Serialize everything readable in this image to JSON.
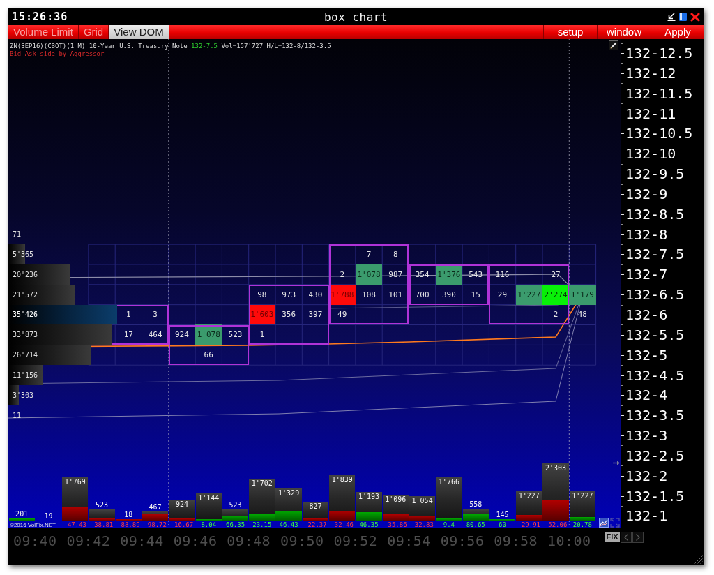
{
  "title_bar": {
    "clock": "15:26:36",
    "title": "box chart"
  },
  "menu": {
    "toggles": [
      {
        "label": "Volume Limit",
        "on": false
      },
      {
        "label": "Grid",
        "on": false
      },
      {
        "label": "View DOM",
        "on": true
      }
    ],
    "actions": [
      "setup",
      "window",
      "Apply"
    ]
  },
  "info": {
    "instrument": "ZN(SEP16)(CBOT)(1 M) 10-Year U.S. Treasury Note",
    "last_price": "132-7.5",
    "stats": "Vol=157'727 H/L=132-8/132-3.5",
    "mode": "Bid-Ask side by Aggressor"
  },
  "price_rows": [
    {
      "price": "132-12.5"
    },
    {
      "price": "132-12"
    },
    {
      "price": "132-11.5"
    },
    {
      "price": "132-11"
    },
    {
      "price": "132-10.5"
    },
    {
      "price": "132-10"
    },
    {
      "price": "132-9.5"
    },
    {
      "price": "132-9"
    },
    {
      "price": "132-8.5"
    },
    {
      "price": "132-8",
      "profile": {
        "volume": "71",
        "highlighted": false
      }
    },
    {
      "price": "132-7.5",
      "profile": {
        "volume": "5'365",
        "highlighted": false
      },
      "cells": [
        null,
        null,
        null,
        null,
        null,
        null,
        null,
        null,
        null,
        null,
        null,
        null,
        null,
        {
          "text": "7",
          "kind": "plain"
        },
        {
          "text": "8",
          "kind": "plain"
        },
        null,
        null,
        null,
        null,
        null,
        null,
        null
      ]
    },
    {
      "price": "132-7",
      "profile": {
        "volume": "20'236",
        "highlighted": false
      },
      "cells": [
        null,
        null,
        null,
        null,
        null,
        null,
        null,
        null,
        null,
        null,
        null,
        null,
        {
          "text": "2",
          "kind": "plain"
        },
        {
          "text": "1'078",
          "kind": "buy"
        },
        {
          "text": "987",
          "kind": "plain"
        },
        {
          "text": "354",
          "kind": "plain"
        },
        {
          "text": "1'376",
          "kind": "buy"
        },
        {
          "text": "543",
          "kind": "plain"
        },
        {
          "text": "116",
          "kind": "plain"
        },
        null,
        {
          "text": "27",
          "kind": "plain"
        },
        null
      ]
    },
    {
      "price": "132-6.5",
      "profile": {
        "volume": "21'572",
        "highlighted": false
      },
      "cells": [
        null,
        null,
        null,
        null,
        null,
        null,
        null,
        null,
        null,
        {
          "text": "98",
          "kind": "plain"
        },
        {
          "text": "973",
          "kind": "plain"
        },
        {
          "text": "430",
          "kind": "plain"
        },
        {
          "text": "1'788",
          "kind": "sell"
        },
        {
          "text": "108",
          "kind": "plain"
        },
        {
          "text": "101",
          "kind": "plain"
        },
        {
          "text": "700",
          "kind": "plain"
        },
        {
          "text": "390",
          "kind": "plain"
        },
        {
          "text": "15",
          "kind": "plain"
        },
        {
          "text": "29",
          "kind": "plain"
        },
        {
          "text": "1'227",
          "kind": "buy"
        },
        {
          "text": "2'274",
          "kind": "strong_buy"
        },
        {
          "text": "1'179",
          "kind": "buy"
        }
      ]
    },
    {
      "price": "132-6",
      "profile": {
        "volume": "35'426",
        "highlighted": true
      },
      "cells": [
        null,
        null,
        null,
        null,
        {
          "text": "1",
          "kind": "plain"
        },
        {
          "text": "3",
          "kind": "plain"
        },
        null,
        null,
        null,
        {
          "text": "1'603",
          "kind": "sell"
        },
        {
          "text": "356",
          "kind": "plain"
        },
        {
          "text": "397",
          "kind": "plain"
        },
        {
          "text": "49",
          "kind": "plain"
        },
        null,
        null,
        null,
        null,
        null,
        null,
        null,
        {
          "text": "2",
          "kind": "plain"
        },
        {
          "text": "48",
          "kind": "plain"
        }
      ]
    },
    {
      "price": "132-5.5",
      "profile": {
        "volume": "33'873",
        "highlighted": false
      },
      "cells": [
        null,
        null,
        null,
        null,
        {
          "text": "17",
          "kind": "plain"
        },
        {
          "text": "464",
          "kind": "plain"
        },
        {
          "text": "924",
          "kind": "plain"
        },
        {
          "text": "1'078",
          "kind": "buy"
        },
        {
          "text": "523",
          "kind": "plain"
        },
        {
          "text": "1",
          "kind": "plain"
        },
        null,
        null,
        null,
        null,
        null,
        null,
        null,
        null,
        null,
        null,
        null,
        null
      ]
    },
    {
      "price": "132-5",
      "profile": {
        "volume": "26'714",
        "highlighted": false
      },
      "cells": [
        null,
        null,
        null,
        null,
        null,
        null,
        null,
        {
          "text": "66",
          "kind": "plain"
        },
        null,
        null,
        null,
        null,
        null,
        null,
        null,
        null,
        null,
        null,
        null,
        null,
        null,
        null
      ]
    },
    {
      "price": "132-4.5",
      "profile": {
        "volume": "11'156",
        "highlighted": false
      }
    },
    {
      "price": "132-4",
      "profile": {
        "volume": "3'303",
        "highlighted": false
      }
    },
    {
      "price": "132-3.5",
      "profile": {
        "volume": "11",
        "highlighted": false
      }
    },
    {
      "price": "132-3"
    },
    {
      "price": "132-2.5"
    },
    {
      "price": "132-2"
    },
    {
      "price": "132-1.5"
    },
    {
      "price": "132-1"
    }
  ],
  "volume_bars": [
    {
      "volume": "201",
      "delta": {
        "kind": "buy"
      }
    },
    {
      "volume": "19"
    },
    {
      "volume": "1'769",
      "delta": {
        "value": "-47.43",
        "kind": "sell"
      }
    },
    {
      "volume": "523",
      "delta": {
        "value": "-38.81",
        "kind": "sell"
      }
    },
    {
      "volume": "18",
      "delta": {
        "value": "-88.89",
        "kind": "sell"
      }
    },
    {
      "volume": "467",
      "delta": {
        "value": "-98.72",
        "kind": "sell"
      }
    },
    {
      "volume": "924",
      "delta": {
        "value": "-16.67",
        "kind": "sell"
      }
    },
    {
      "volume": "1'144",
      "delta": {
        "value": "8.04",
        "kind": "buy"
      }
    },
    {
      "volume": "523",
      "delta": {
        "value": "66.35",
        "kind": "buy"
      }
    },
    {
      "volume": "1'702",
      "delta": {
        "value": "23.15",
        "kind": "buy"
      }
    },
    {
      "volume": "1'329",
      "delta": {
        "value": "46.43",
        "kind": "buy"
      }
    },
    {
      "volume": "827",
      "delta": {
        "value": "-22.37",
        "kind": "sell"
      }
    },
    {
      "volume": "1'839",
      "delta": {
        "value": "-32.46",
        "kind": "sell"
      }
    },
    {
      "volume": "1'193",
      "delta": {
        "value": "46.35",
        "kind": "buy"
      }
    },
    {
      "volume": "1'096",
      "delta": {
        "value": "-35.86",
        "kind": "sell"
      }
    },
    {
      "volume": "1'054",
      "delta": {
        "value": "-32.83",
        "kind": "sell"
      }
    },
    {
      "volume": "1'766",
      "delta": {
        "value": "9.4",
        "kind": "buy"
      }
    },
    {
      "volume": "558",
      "delta": {
        "value": "80.65",
        "kind": "buy"
      }
    },
    {
      "volume": "145",
      "delta": {
        "value": "60",
        "kind": "buy"
      }
    },
    {
      "volume": "1'227",
      "delta": {
        "value": "-29.91",
        "kind": "sell"
      }
    },
    {
      "volume": "2'303",
      "delta": {
        "value": "-52.06",
        "kind": "sell"
      }
    },
    {
      "volume": "1'227",
      "delta": {
        "value": "20.78",
        "kind": "buy"
      }
    }
  ],
  "copyright": "©2016 VolFix.NET",
  "time_axis": [
    "09:40",
    "09:42",
    "09:44",
    "09:46",
    "09:48",
    "09:50",
    "09:52",
    "09:54",
    "09:56",
    "09:58",
    "10:00"
  ],
  "fix_button": "FIX"
}
